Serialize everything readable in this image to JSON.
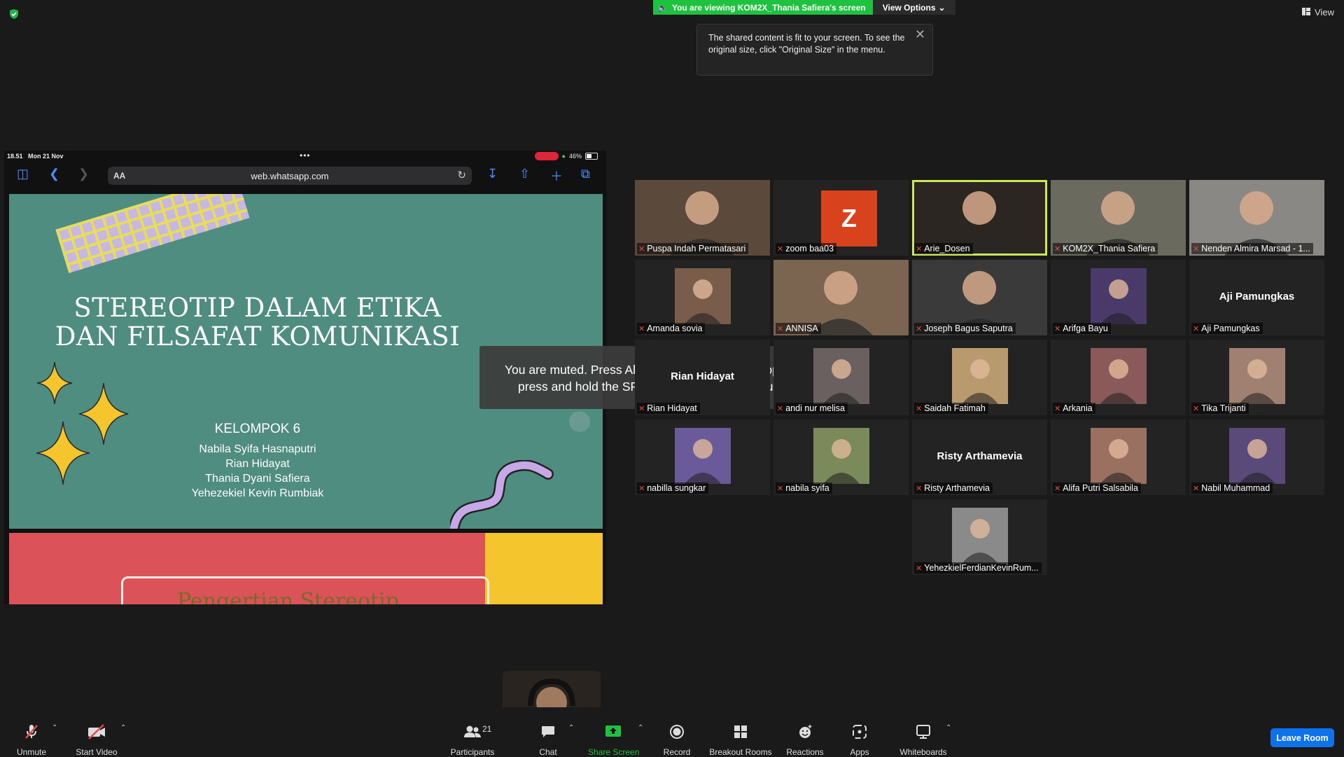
{
  "colors": {
    "accent": "#0e72ed",
    "share_green": "#1ec23f",
    "active_speaker": "#c9e75a",
    "muted_red": "#e24b4b"
  },
  "top": {
    "share_banner": "You are viewing KOM2X_Thania Safiera's screen",
    "view_options": "View Options",
    "view": "View",
    "tooltip": "The shared content is fit to your screen. To see the original size, click \"Original Size\" in the menu."
  },
  "shared_screen": {
    "status_time": "18.51",
    "status_date": "Mon 21 Nov",
    "battery": "46%",
    "url_aa": "AA",
    "url": "web.whatsapp.com",
    "slide": {
      "title_line1": "STEREOTIP DALAM ETIKA",
      "title_line2": "DAN FILSAFAT KOMUNIKASI",
      "group": "KELOMPOK 6",
      "names": [
        "Nabila Syifa Hasnaputri",
        "Rian Hidayat",
        "Thania Dyani Safiera",
        "Yehezekiel Kevin Rumbiak"
      ]
    },
    "slide2_title": "Pengertian Stereotip"
  },
  "toast": {
    "line1": "You are muted. Press Alt+A to unmute your microphone, or",
    "line2": "press and hold the SPACE key to temporarily unmute."
  },
  "participants": [
    {
      "name": "Puspa Indah Permatasari",
      "type": "video",
      "color": "#5b4a3c"
    },
    {
      "name": "zoom baa03",
      "type": "avatar",
      "letter": "Z"
    },
    {
      "name": "Arie_Dosen",
      "type": "video",
      "color": "#2c2622",
      "active": true
    },
    {
      "name": "KOM2X_Thania Safiera",
      "type": "video",
      "color": "#6b6a5e"
    },
    {
      "name": "Nenden Almira Marsad - 1...",
      "type": "video",
      "color": "#8a8884"
    },
    {
      "name": "Amanda sovia",
      "type": "photo",
      "color": "#7a5c4a"
    },
    {
      "name": "ANNISA",
      "type": "video",
      "color": "#7b6450"
    },
    {
      "name": "Joseph Bagus Saputra",
      "type": "video",
      "color": "#3a3a3a"
    },
    {
      "name": "Arifga Bayu",
      "type": "photo",
      "color": "#4a3a6a"
    },
    {
      "name": "Aji Pamungkas",
      "type": "name",
      "big_name": "Aji Pamungkas"
    },
    {
      "name": "Rian Hidayat",
      "type": "name",
      "big_name": "Rian Hidayat"
    },
    {
      "name": "andi nur melisa",
      "type": "photo",
      "color": "#6a6060"
    },
    {
      "name": "Saidah Fatimah",
      "type": "photo",
      "color": "#b89a6e"
    },
    {
      "name": "Arkania",
      "type": "photo",
      "color": "#8a5a5a"
    },
    {
      "name": "Tika Trijanti",
      "type": "photo",
      "color": "#a08070"
    },
    {
      "name": "nabilla sungkar",
      "type": "photo",
      "color": "#6a5a9a"
    },
    {
      "name": "nabila syifa",
      "type": "photo",
      "color": "#7a8a5a"
    },
    {
      "name": "Risty Arthamevia",
      "type": "name",
      "big_name": "Risty Arthamevia"
    },
    {
      "name": "Alifa Putri Salsabila",
      "type": "photo",
      "color": "#9a7060"
    },
    {
      "name": "Nabil Muhammad",
      "type": "photo",
      "color": "#5a4a7a"
    },
    {
      "name": "YehezkielFerdianKevinRum...",
      "type": "photo",
      "color": "#8a8a8a"
    }
  ],
  "toolbar": {
    "unmute": "Unmute",
    "start_video": "Start Video",
    "participants": "Participants",
    "participants_count": "21",
    "chat": "Chat",
    "share_screen": "Share Screen",
    "record": "Record",
    "breakout_rooms": "Breakout Rooms",
    "reactions": "Reactions",
    "apps": "Apps",
    "whiteboards": "Whiteboards",
    "leave": "Leave Room"
  }
}
